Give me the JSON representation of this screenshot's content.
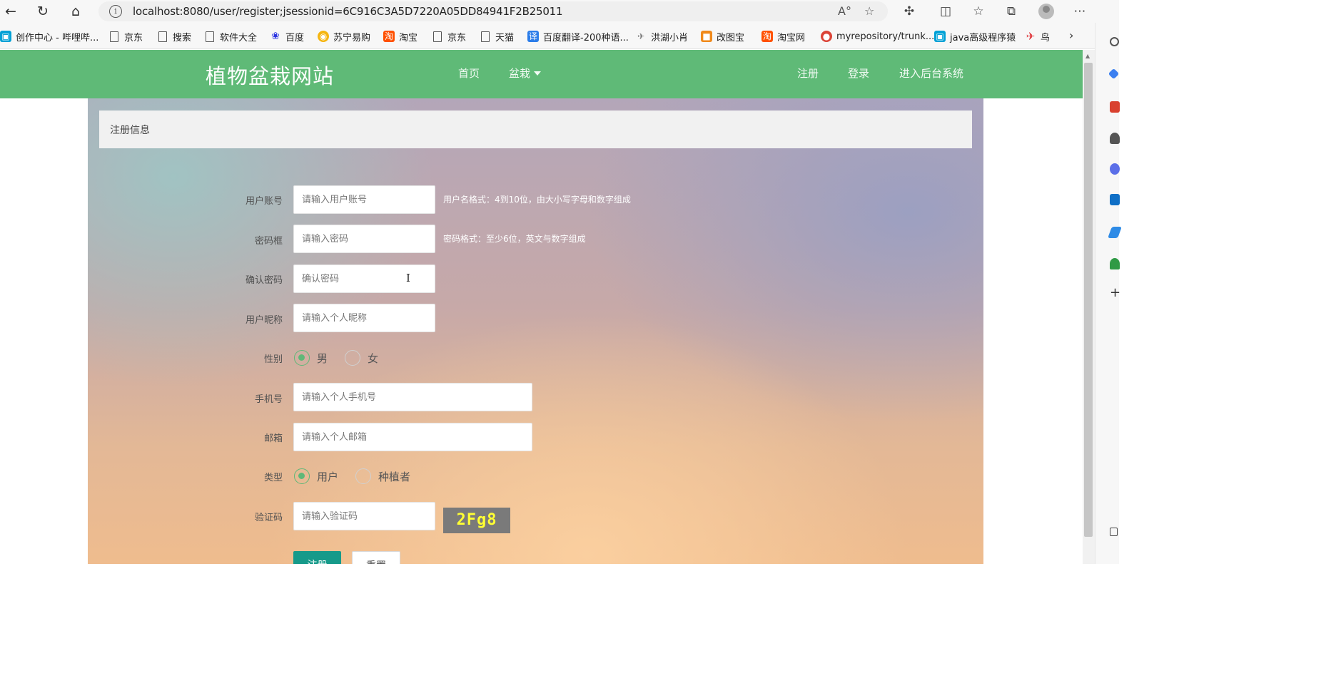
{
  "browser": {
    "url": "localhost:8080/user/register;jsessionid=6C916C3A5D7220A05DD84941F2B25011",
    "bookmarks": [
      {
        "label": "创作中心 - 哔哩哔...",
        "icon": "bilibili-icon",
        "color": "#00a1d6"
      },
      {
        "label": "京东",
        "icon": "file-icon"
      },
      {
        "label": "搜索",
        "icon": "file-icon"
      },
      {
        "label": "软件大全",
        "icon": "file-icon"
      },
      {
        "label": "百度",
        "icon": "baidu-paw-icon",
        "color": "#2932e1"
      },
      {
        "label": "苏宁易购",
        "icon": "suning-icon",
        "color": "#f5b50f"
      },
      {
        "label": "淘宝",
        "icon": "taobao-icon",
        "color": "#ff5000"
      },
      {
        "label": "京东",
        "icon": "file-icon"
      },
      {
        "label": "天猫",
        "icon": "file-icon"
      },
      {
        "label": "百度翻译-200种语...",
        "icon": "baidu-translate-icon",
        "color": "#2b7de9"
      },
      {
        "label": "洪湖小肖",
        "icon": "bird-icon",
        "color": "#777777"
      },
      {
        "label": "改图宝",
        "icon": "gaitubao-icon",
        "color": "#f08a1c"
      },
      {
        "label": "淘宝网",
        "icon": "taobao-icon",
        "color": "#ff5000"
      },
      {
        "label": "myrepository/trunk...",
        "icon": "chrome-icon",
        "color": "#db4437"
      },
      {
        "label": "java高级程序猿",
        "icon": "bilibili-icon",
        "color": "#00a1d6"
      },
      {
        "label": "鸟",
        "icon": "bird-icon",
        "color": "#e0393e"
      }
    ]
  },
  "navbar": {
    "brand": "植物盆栽网站",
    "links": {
      "home": "首页",
      "bonsai": "盆栽",
      "register": "注册",
      "login": "登录",
      "admin": "进入后台系统"
    },
    "color": "#5fba77"
  },
  "panel": {
    "title": "注册信息"
  },
  "form": {
    "username": {
      "label": "用户账号",
      "placeholder": "请输入用户账号",
      "hint": "用户名格式：4到10位，由大小写字母和数字组成"
    },
    "password": {
      "label": "密码框",
      "placeholder": "请输入密码",
      "hint": "密码格式：至少6位，英文与数字组成"
    },
    "confirm": {
      "label": "确认密码",
      "placeholder": "确认密码"
    },
    "nickname": {
      "label": "用户昵称",
      "placeholder": "请输入个人昵称"
    },
    "gender": {
      "label": "性别",
      "options": [
        "男",
        "女"
      ],
      "selected": "男"
    },
    "phone": {
      "label": "手机号",
      "placeholder": "请输入个人手机号"
    },
    "email": {
      "label": "邮箱",
      "placeholder": "请输入个人邮箱"
    },
    "type": {
      "label": "类型",
      "options": [
        "用户",
        "种植者"
      ],
      "selected": "用户"
    },
    "captcha": {
      "label": "验证码",
      "placeholder": "请输入验证码",
      "code": "2Fg8"
    },
    "submit": "注册",
    "reset": "重置",
    "accent": "#5fb878"
  }
}
